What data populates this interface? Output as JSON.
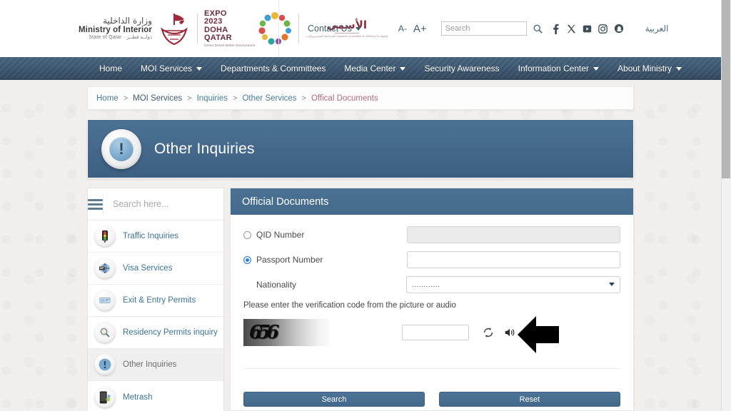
{
  "header": {
    "logo": {
      "ministry_ar": "وزارة الداخلية",
      "ministry_en": "Ministry of Interior",
      "ministry_sub": "State of Qatar  ·  دولــة قطــر",
      "expo_line1": "EXPO",
      "expo_line2": "2023",
      "expo_line3": "DOHA",
      "expo_line4": "QATAR",
      "expo_sub": "Green Desert\nBetter Environment",
      "alasmaa_ar": "الأسمى",
      "alasmaa_sub": "اللجنة العليا للمشاريع والإرث\nSupreme Committee for Delivery & Legacy"
    },
    "contact_us": "Contact Us",
    "font_decrease": "A-",
    "font_increase": "A+",
    "search_placeholder": "Search",
    "search_value": "",
    "social": [
      {
        "name": "facebook-icon",
        "glyph": "f"
      },
      {
        "name": "x-twitter-icon",
        "glyph": "✕"
      },
      {
        "name": "youtube-icon",
        "glyph": "▶"
      },
      {
        "name": "instagram-icon",
        "glyph": "◻"
      },
      {
        "name": "snapchat-icon",
        "glyph": "◉"
      }
    ],
    "arabic_link": "العربية"
  },
  "nav": {
    "items": [
      {
        "label": "Home",
        "has_dropdown": false
      },
      {
        "label": "MOI Services",
        "has_dropdown": true
      },
      {
        "label": "Departments & Committees",
        "has_dropdown": false
      },
      {
        "label": "Media Center",
        "has_dropdown": true
      },
      {
        "label": "Security Awareness",
        "has_dropdown": false
      },
      {
        "label": "Information Center",
        "has_dropdown": true
      },
      {
        "label": "About Ministry",
        "has_dropdown": true
      }
    ]
  },
  "breadcrumb": {
    "separator": ">",
    "items": [
      {
        "label": "Home",
        "state": "link"
      },
      {
        "label": "MOI Services",
        "state": "dark"
      },
      {
        "label": "Inquiries",
        "state": "link"
      },
      {
        "label": "Other Services",
        "state": "link"
      },
      {
        "label": "Offical Documents",
        "state": "current"
      }
    ]
  },
  "banner": {
    "title": "Other Inquiries",
    "icon_glyph": "!"
  },
  "sidebar": {
    "search_placeholder": "Search here...",
    "search_value": "",
    "items": [
      {
        "label": "Traffic Inquiries",
        "icon": "traffic-light-icon",
        "glyph": "🚦",
        "active": false
      },
      {
        "label": "Visa Services",
        "icon": "visa-icon",
        "glyph": "🛂",
        "active": false
      },
      {
        "label": "Exit & Entry Permits",
        "icon": "exit-entry-icon",
        "glyph": "🎫",
        "active": false
      },
      {
        "label": "Residency Permits inquiry",
        "icon": "residency-search-icon",
        "glyph": "🔍",
        "active": false
      },
      {
        "label": "Other Inquiries",
        "icon": "exclamation-icon",
        "glyph": "❗",
        "active": true
      },
      {
        "label": "Metrash",
        "icon": "metrash-phone-icon",
        "glyph": "📱",
        "active": false
      }
    ]
  },
  "form": {
    "panel_title": "Official Documents",
    "qid_label": "QID Number",
    "qid_selected": false,
    "qid_value": "",
    "qid_disabled": true,
    "passport_label": "Passport Number",
    "passport_selected": true,
    "passport_value": "",
    "nationality_label": "Nationality",
    "nationality_value": "............",
    "verification_text": "Please enter the verification code from the picture or audio",
    "captcha_code": "656",
    "captcha_input_value": "",
    "refresh_icon": "refresh-icon",
    "audio_icon": "speaker-icon",
    "search_button": "Search",
    "reset_button": "Reset"
  },
  "colors": {
    "nav_blue": "#3e5972",
    "panel_header_blue": "#446a8c",
    "banner_blue": "#44688a",
    "link_blue": "#3d7394",
    "breadcrumb_current": "#b06a78",
    "button_blue": "#43688a",
    "page_bg": "#f2f0ee"
  }
}
